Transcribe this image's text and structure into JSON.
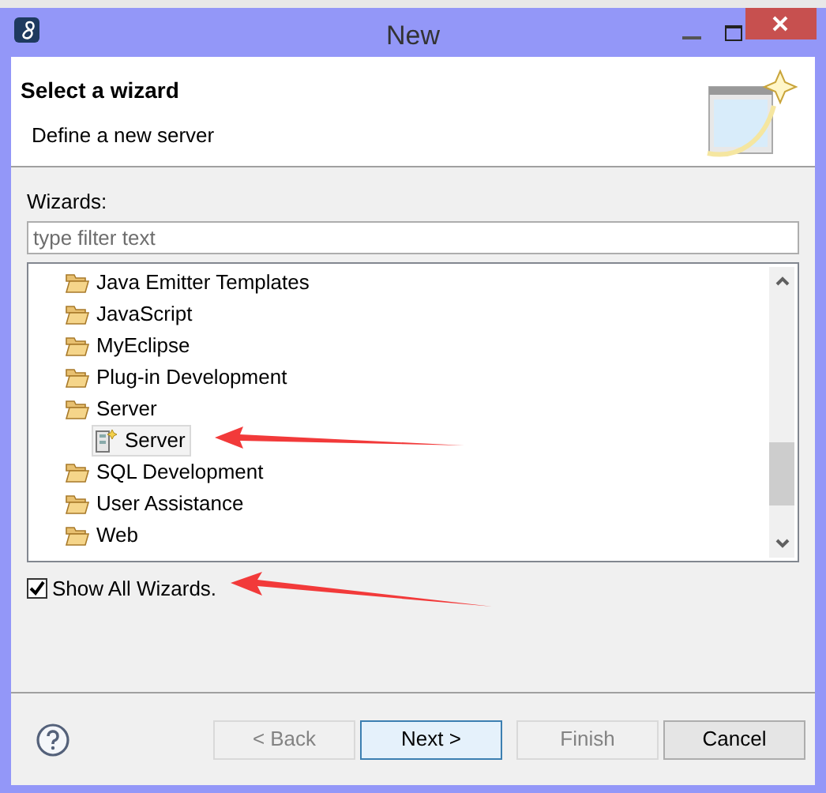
{
  "window": {
    "title": "New"
  },
  "header": {
    "title": "Select a wizard",
    "description": "Define a new server"
  },
  "wizards_label": "Wizards:",
  "filter": {
    "placeholder": "type filter text"
  },
  "tree": [
    {
      "label": "Java Emitter Templates",
      "selected": false
    },
    {
      "label": "JavaScript",
      "selected": false
    },
    {
      "label": "MyEclipse",
      "selected": false
    },
    {
      "label": "Plug-in Development",
      "selected": false
    },
    {
      "label": "Server",
      "selected": false,
      "children": [
        {
          "label": "Server",
          "selected": true
        }
      ]
    },
    {
      "label": "SQL Development",
      "selected": false
    },
    {
      "label": "User Assistance",
      "selected": false
    },
    {
      "label": "Web",
      "selected": false
    }
  ],
  "show_all": {
    "label": "Show All Wizards.",
    "checked": true
  },
  "buttons": [
    {
      "label": "< Back",
      "disabled": true,
      "default": false
    },
    {
      "label": "Next >",
      "disabled": false,
      "default": true
    },
    {
      "label": "Finish",
      "disabled": true,
      "default": false
    },
    {
      "label": "Cancel",
      "disabled": false,
      "default": false
    }
  ]
}
